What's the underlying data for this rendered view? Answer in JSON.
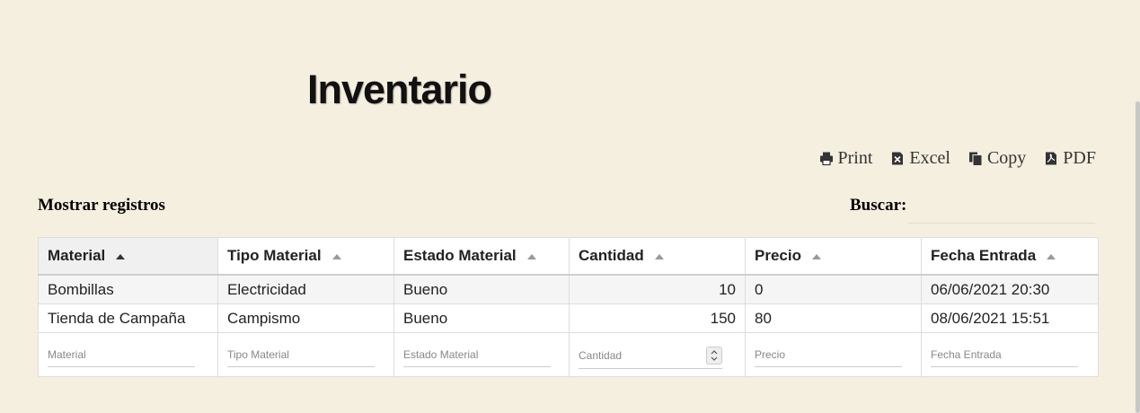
{
  "page": {
    "title": "Inventario"
  },
  "toolbar": {
    "buttons": [
      {
        "label": "Print",
        "icon": "printer-icon"
      },
      {
        "label": "Excel",
        "icon": "excel-icon"
      },
      {
        "label": "Copy",
        "icon": "copy-icon"
      },
      {
        "label": "PDF",
        "icon": "pdf-icon"
      }
    ]
  },
  "controls": {
    "length_label": "Mostrar registros",
    "search_label": "Buscar:",
    "search_value": ""
  },
  "table": {
    "columns": [
      {
        "label": "Material",
        "sorted": true
      },
      {
        "label": "Tipo Material",
        "sorted": false
      },
      {
        "label": "Estado Material",
        "sorted": false
      },
      {
        "label": "Cantidad",
        "sorted": false
      },
      {
        "label": "Precio",
        "sorted": false
      },
      {
        "label": "Fecha Entrada",
        "sorted": false
      }
    ],
    "rows": [
      [
        "Bombillas",
        "Electricidad",
        "Bueno",
        "10",
        "0",
        "06/06/2021 20:30"
      ],
      [
        "Tienda de Campaña",
        "Campismo",
        "Bueno",
        "150",
        "80",
        "08/06/2021 15:51"
      ]
    ],
    "filters": [
      {
        "placeholder": "Material"
      },
      {
        "placeholder": "Tipo Material"
      },
      {
        "placeholder": "Estado Material"
      },
      {
        "placeholder": "Cantidad"
      },
      {
        "placeholder": "Precio"
      },
      {
        "placeholder": "Fecha Entrada"
      }
    ]
  },
  "colors": {
    "background": "#f5efdf",
    "sorted_header": "#f0f0f0",
    "odd_row": "#f5f5f5"
  }
}
